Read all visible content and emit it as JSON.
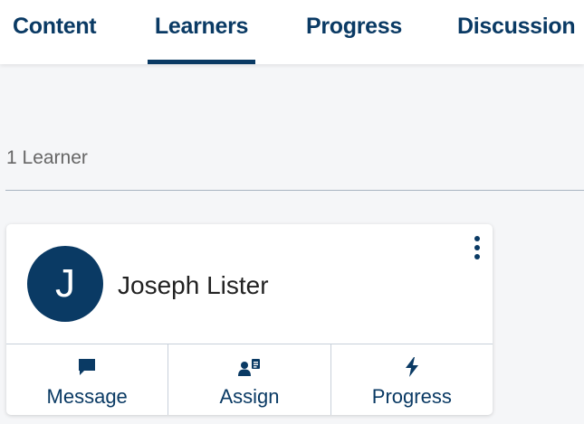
{
  "tabs": [
    {
      "label": "Content"
    },
    {
      "label": "Learners"
    },
    {
      "label": "Progress"
    },
    {
      "label": "Discussion"
    }
  ],
  "active_tab": "Learners",
  "learner_count_label": "1 Learner",
  "learner": {
    "initial": "J",
    "name": "Joseph Lister"
  },
  "actions": [
    {
      "label": "Message",
      "icon": "message-icon"
    },
    {
      "label": "Assign",
      "icon": "assign-icon"
    },
    {
      "label": "Progress",
      "icon": "lightning-icon"
    }
  ],
  "colors": {
    "primary": "#0a3a64",
    "background": "#f5f6f8"
  }
}
